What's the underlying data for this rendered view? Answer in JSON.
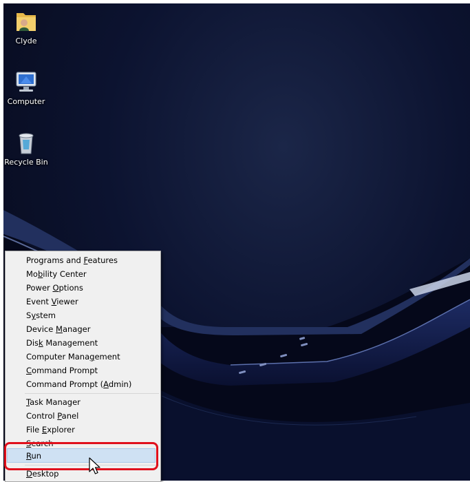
{
  "desktop": {
    "icons": [
      {
        "id": "user-folder",
        "label": "Clyde"
      },
      {
        "id": "computer",
        "label": "Computer"
      },
      {
        "id": "recycle-bin",
        "label": "Recycle Bin"
      }
    ]
  },
  "winx_menu": {
    "groups": [
      [
        {
          "pre": "Programs and ",
          "u": "F",
          "post": "eatures"
        },
        {
          "pre": "Mo",
          "u": "b",
          "post": "ility Center"
        },
        {
          "pre": "Power ",
          "u": "O",
          "post": "ptions"
        },
        {
          "pre": "Event ",
          "u": "V",
          "post": "iewer"
        },
        {
          "pre": "S",
          "u": "y",
          "post": "stem"
        },
        {
          "pre": "Device ",
          "u": "M",
          "post": "anager"
        },
        {
          "pre": "Dis",
          "u": "k",
          "post": " Management"
        },
        {
          "pre": "Computer Mana",
          "u": "g",
          "post": "ement"
        },
        {
          "pre": "",
          "u": "C",
          "post": "ommand Prompt"
        },
        {
          "pre": "Command Prompt (",
          "u": "A",
          "post": "dmin)"
        }
      ],
      [
        {
          "pre": "",
          "u": "T",
          "post": "ask Manager"
        },
        {
          "pre": "Control ",
          "u": "P",
          "post": "anel"
        },
        {
          "pre": "File ",
          "u": "E",
          "post": "xplorer"
        },
        {
          "pre": "",
          "u": "S",
          "post": "earch"
        },
        {
          "pre": "",
          "u": "R",
          "post": "un"
        }
      ],
      [
        {
          "pre": "",
          "u": "D",
          "post": "esktop"
        }
      ]
    ],
    "highlighted_item": "Run"
  },
  "annotation": {
    "callout_color": "#e0101c",
    "target": "Run"
  }
}
